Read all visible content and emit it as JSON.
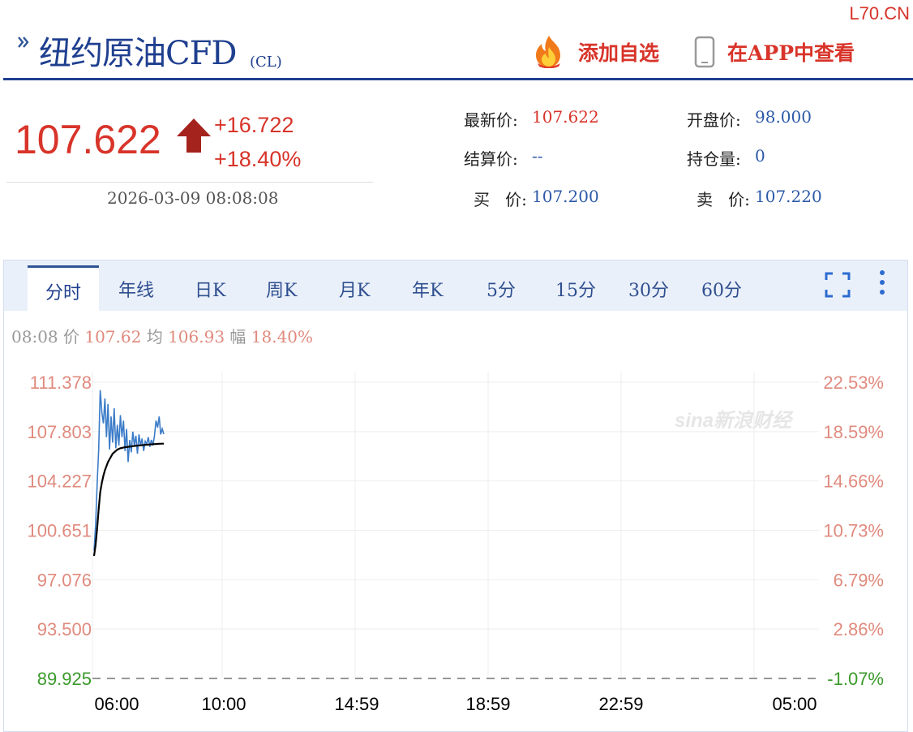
{
  "site_watermark": "L70.CN",
  "header": {
    "title": "纽约原油CFD",
    "code": "(CL)",
    "favorite_label": "添加自选",
    "app_label": "在APP中查看",
    "icons": [
      "chevron-double-right-icon",
      "fire-icon",
      "phone-icon"
    ]
  },
  "quote": {
    "last": "107.622",
    "change": "+16.722",
    "change_pct": "+18.40%",
    "time": "2026-03-09 08:08:08",
    "fields": {
      "latest": {
        "label": "最新价:",
        "value": "107.622"
      },
      "open": {
        "label": "开盘价:",
        "value": "98.000"
      },
      "settle": {
        "label": "结算价:",
        "value": "--"
      },
      "open_interest": {
        "label": "持仓量:",
        "value": "0"
      },
      "bid": {
        "label": "买   价:",
        "value": "107.200"
      },
      "ask": {
        "label": "卖   价:",
        "value": "107.220"
      }
    }
  },
  "tabs": [
    "分时",
    "年线",
    "日K",
    "周K",
    "月K",
    "年K",
    "5分",
    "15分",
    "30分",
    "60分"
  ],
  "active_tab": "分时",
  "info_line": {
    "time": "08:08",
    "price_label": "价",
    "price": "107.62",
    "avg_label": "均",
    "avg": "106.93",
    "amp_label": "幅",
    "amp": "18.40%"
  },
  "chart_watermark": "sina新浪财经",
  "colors": {
    "up": "#d8342a",
    "accent": "#1f3f8f",
    "price_line": "#3b7bc8",
    "avg_line": "#000000",
    "base_line": "#3a9a2a",
    "axis_label": "#e08a7e"
  },
  "chart_data": {
    "type": "line",
    "y_left_ticks": [
      "111.378",
      "107.803",
      "104.227",
      "100.651",
      "97.076",
      "93.500",
      "89.925"
    ],
    "y_right_ticks": [
      "22.53%",
      "18.59%",
      "14.66%",
      "10.73%",
      "6.79%",
      "2.86%",
      "-1.07%"
    ],
    "x_ticks": [
      "06:00",
      "10:00",
      "14:59",
      "18:59",
      "22:59",
      "05:00"
    ],
    "ylim": [
      89.925,
      111.378
    ],
    "base_value": 89.925,
    "grid": true,
    "series": [
      {
        "role": "price",
        "values": [
          99.2,
          101.0,
          104.0,
          106.5,
          110.8,
          109.2,
          108.4,
          110.2,
          107.4,
          109.8,
          106.5,
          108.9,
          107.0,
          109.5,
          106.6,
          108.3,
          106.8,
          109.0,
          107.4,
          108.6,
          106.4,
          108.0,
          105.6,
          107.2,
          106.3,
          107.8,
          106.8,
          107.5,
          106.2,
          107.6,
          106.8,
          107.3,
          106.4,
          107.1,
          106.9,
          107.4,
          106.7,
          107.2,
          106.8,
          107.5,
          108.6,
          108.1,
          108.9,
          107.6,
          108.0,
          107.62
        ]
      },
      {
        "role": "average",
        "values": [
          98.8,
          99.6,
          100.8,
          102.2,
          103.4,
          104.1,
          104.6,
          105.0,
          105.3,
          105.6,
          105.8,
          106.0,
          106.2,
          106.3,
          106.4,
          106.5,
          106.55,
          106.6,
          106.62,
          106.65,
          106.67,
          106.69,
          106.7,
          106.72,
          106.73,
          106.75,
          106.76,
          106.78,
          106.79,
          106.8,
          106.81,
          106.82,
          106.83,
          106.84,
          106.85,
          106.86,
          106.87,
          106.88,
          106.89,
          106.9,
          106.9,
          106.91,
          106.92,
          106.92,
          106.93,
          106.93
        ]
      }
    ]
  }
}
